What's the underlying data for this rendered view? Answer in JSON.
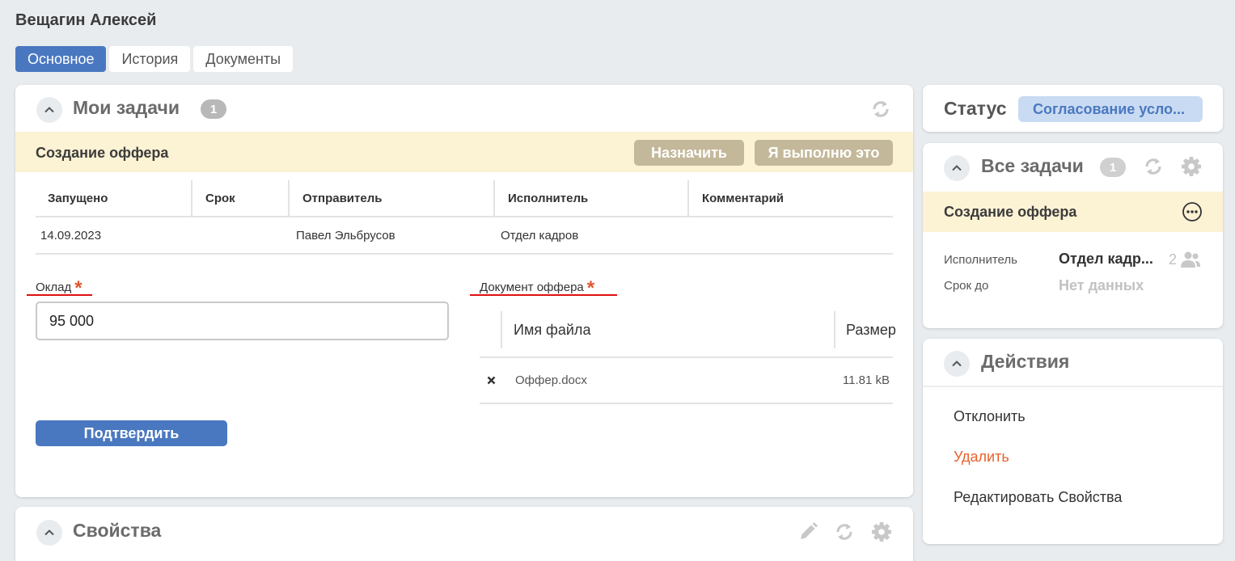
{
  "page": {
    "title": "Вещагин Алексей"
  },
  "tabs": [
    {
      "label": "Основное",
      "active": true
    },
    {
      "label": "История",
      "active": false
    },
    {
      "label": "Документы",
      "active": false
    }
  ],
  "my_tasks": {
    "title": "Мои задачи",
    "count": "1",
    "task": {
      "name": "Создание оффера",
      "assign_label": "Назначить",
      "take_label": "Я выполню это"
    },
    "columns": [
      "Запущено",
      "Срок",
      "Отправитель",
      "Исполнитель",
      "Комментарий"
    ],
    "rows": [
      {
        "started": "14.09.2023",
        "deadline": "",
        "sender": "Павел Эльбрусов",
        "executor": "Отдел кадров",
        "comment": ""
      }
    ],
    "salary": {
      "label": "Оклад",
      "value": "95 000"
    },
    "document": {
      "label": "Документ оффера",
      "columns": [
        "Имя файла",
        "Размер"
      ],
      "files": [
        {
          "name": "Оффер.docx",
          "size": "11.81 kB"
        }
      ]
    },
    "confirm_label": "Подтвердить"
  },
  "properties": {
    "title": "Свойства"
  },
  "status": {
    "label": "Статус",
    "value": "Согласование усло..."
  },
  "all_tasks": {
    "title": "Все задачи",
    "count": "1",
    "task_name": "Создание оффера",
    "executor_label": "Исполнитель",
    "executor_value": "Отдел кадр...",
    "executor_count": "2",
    "deadline_label": "Срок до",
    "deadline_value": "Нет данных"
  },
  "actions": {
    "title": "Действия",
    "items": [
      "Отклонить",
      "Удалить",
      "Редактировать Свойства"
    ]
  },
  "colors": {
    "accent": "#4a78c0",
    "task_band": "#fcf2d4",
    "band_button": "#c4b89a",
    "required": "#e0552f",
    "danger": "#e8612c",
    "annotation_underline": "#e01010"
  },
  "icons": [
    "chevron-up-icon",
    "refresh-icon",
    "gear-icon",
    "pencil-icon",
    "more-icon",
    "people-icon",
    "remove-icon"
  ]
}
